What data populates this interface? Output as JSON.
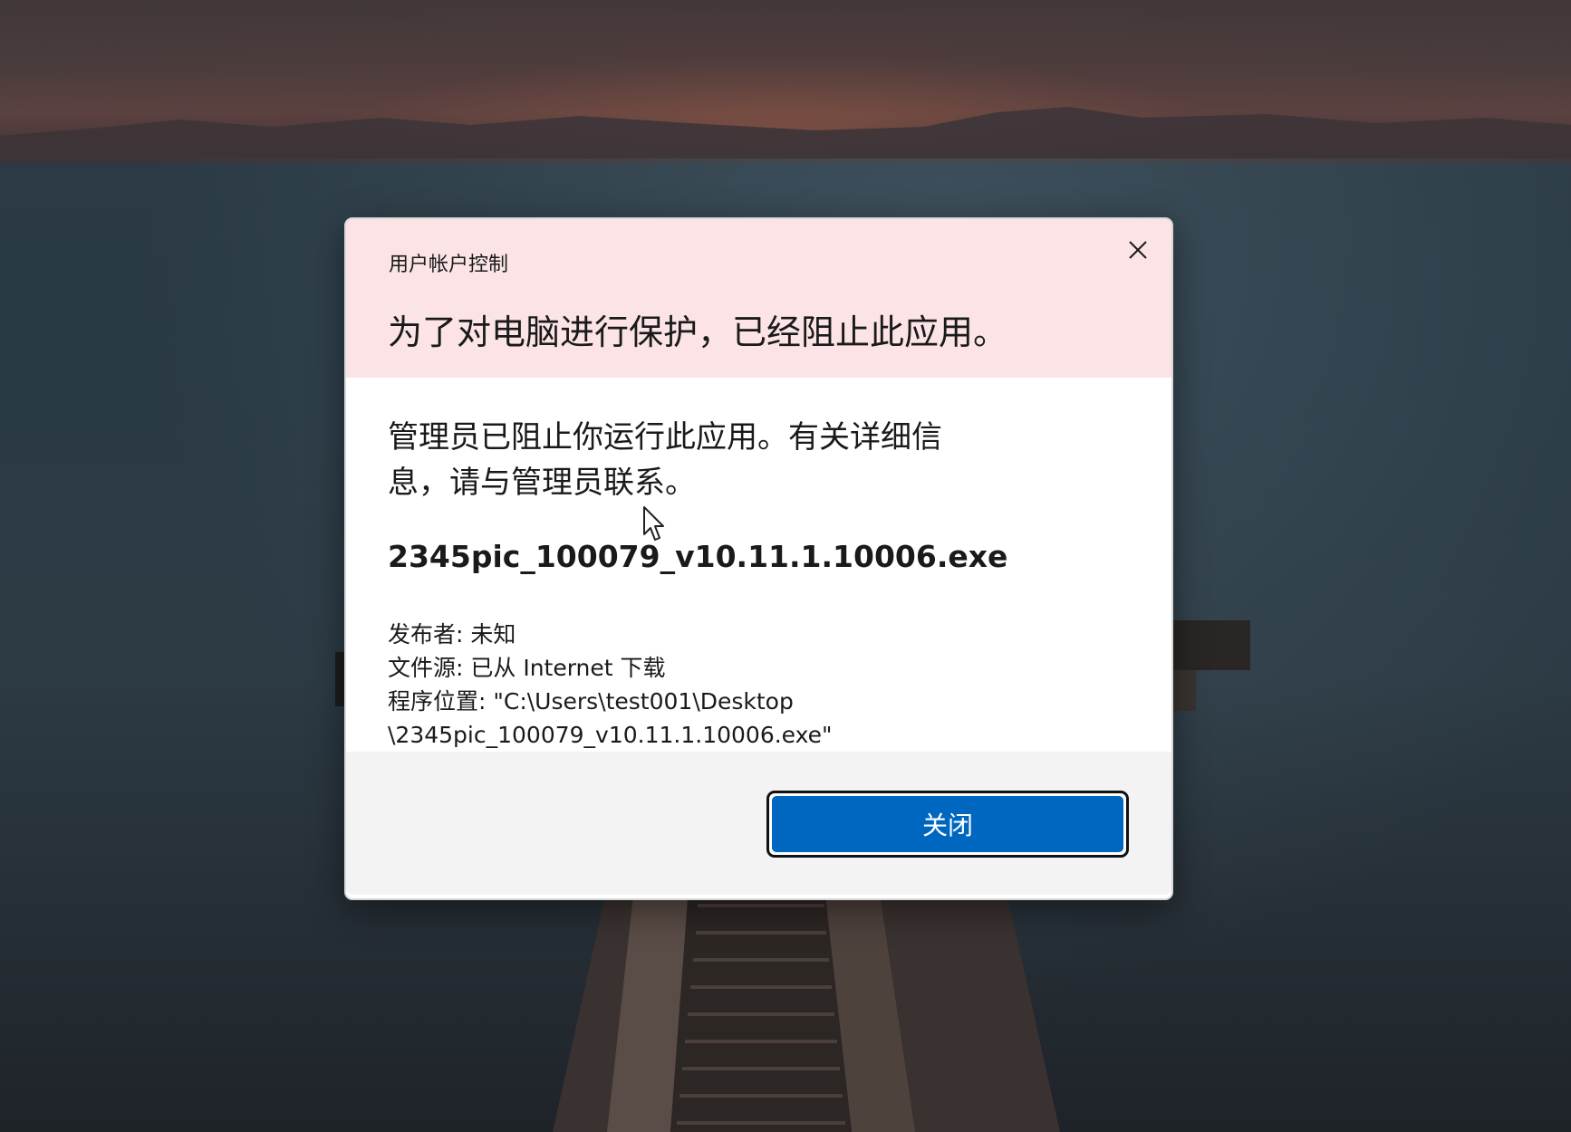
{
  "dialog": {
    "caption": "用户帐户控制",
    "headline": "为了对电脑进行保护，已经阻止此应用。",
    "message_line1": "管理员已阻止你运行此应用。有关详细信",
    "message_line2": "息，请与管理员联系。",
    "file_name": "2345pic_100079_v10.11.1.10006.exe",
    "publisher": "发布者: 未知",
    "file_source": "文件源: 已从 Internet 下载",
    "location_line1": "程序位置: \"C:\\Users\\test001\\Desktop",
    "location_line2": "\\2345pic_100079_v10.11.1.10006.exe\"",
    "close_button_label": "关闭",
    "close_icon": "close-icon"
  },
  "colors": {
    "header_background": "#fce4e6",
    "accent": "#0067c0",
    "footer_background": "#f3f3f3"
  },
  "pointer": "arrow-cursor-icon"
}
